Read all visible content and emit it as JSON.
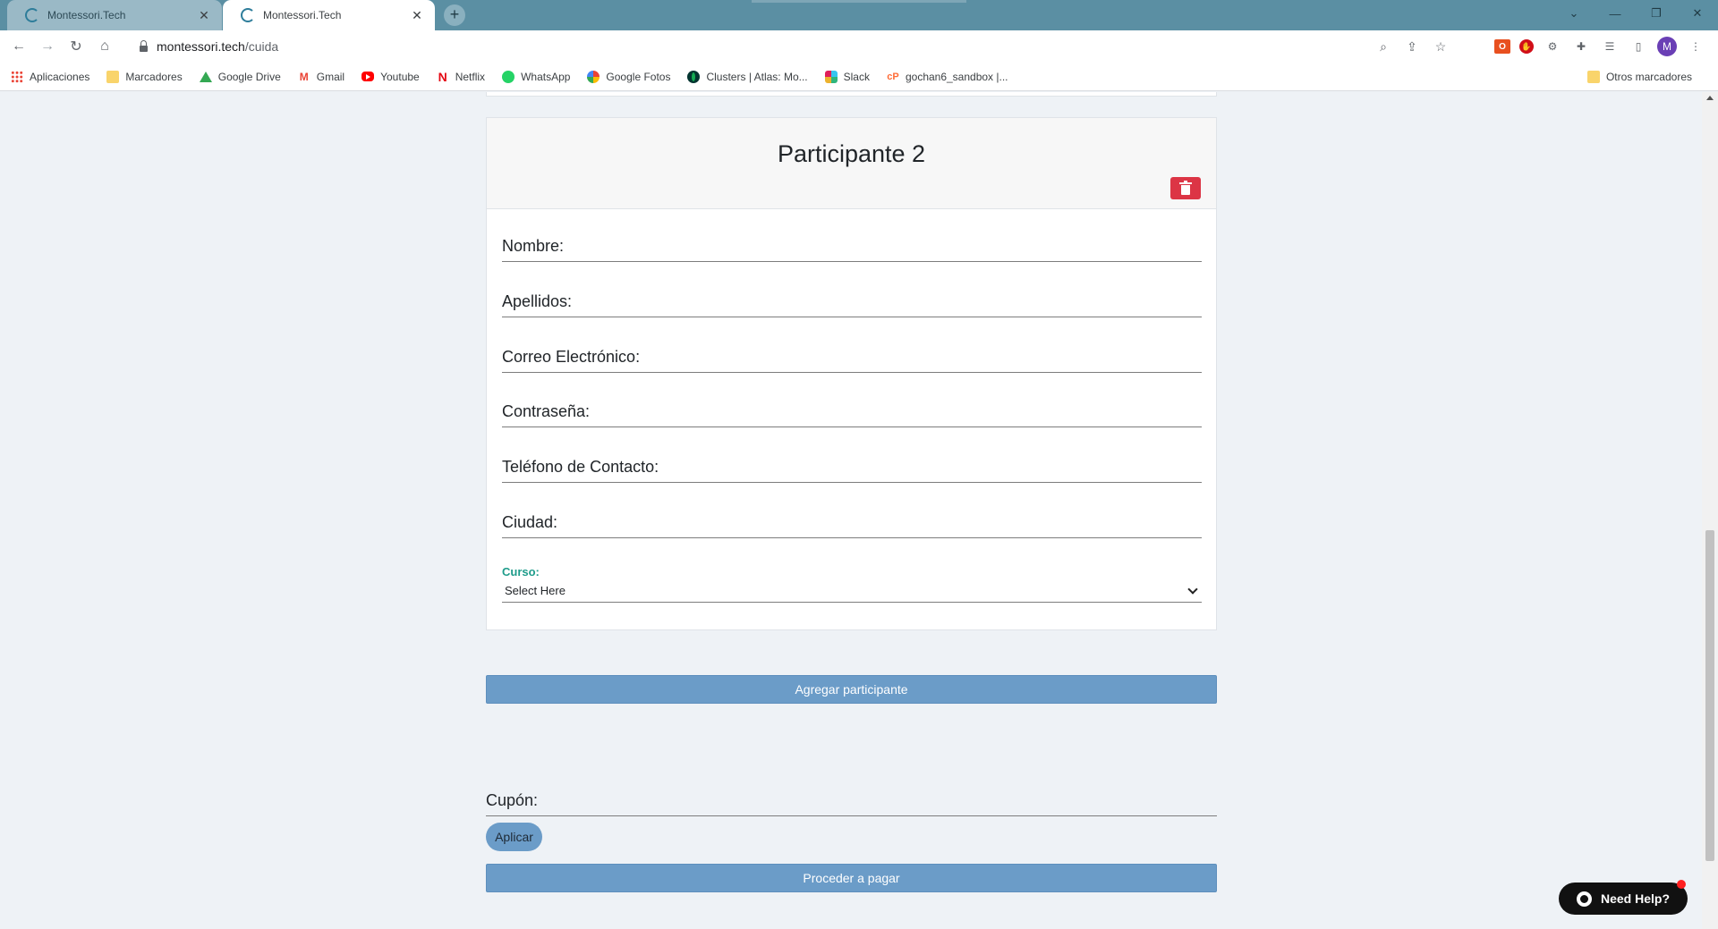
{
  "browser": {
    "tabs": [
      {
        "title": "Montessori.Tech",
        "active": false
      },
      {
        "title": "Montessori.Tech",
        "active": true
      }
    ],
    "new_tab_label": "+",
    "url_host": "montessori.tech",
    "url_path": "/cuida",
    "profile_initial": "M",
    "office_ext_label": "O",
    "bookmarks": [
      {
        "label": "Aplicaciones",
        "icon": "apps-grid-icon"
      },
      {
        "label": "Marcadores",
        "icon": "folder-icon"
      },
      {
        "label": "Google Drive",
        "icon": "google-drive-icon"
      },
      {
        "label": "Gmail",
        "icon": "gmail-icon"
      },
      {
        "label": "Youtube",
        "icon": "youtube-icon"
      },
      {
        "label": "Netflix",
        "icon": "netflix-icon"
      },
      {
        "label": "WhatsApp",
        "icon": "whatsapp-icon"
      },
      {
        "label": "Google Fotos",
        "icon": "google-photos-icon"
      },
      {
        "label": "Clusters | Atlas: Mo...",
        "icon": "mongodb-icon"
      },
      {
        "label": "Slack",
        "icon": "slack-icon"
      },
      {
        "label": "gochan6_sandbox |...",
        "icon": "postman-icon"
      }
    ],
    "other_bookmarks": "Otros marcadores"
  },
  "participant": {
    "title": "Participante 2",
    "fields": {
      "nombre": "Nombre:",
      "apellidos": "Apellidos:",
      "correo": "Correo Electrónico:",
      "contrasena": "Contraseña:",
      "telefono": "Teléfono de Contacto:",
      "ciudad": "Ciudad:"
    },
    "curso_label": "Curso:",
    "curso_selected": "Select Here"
  },
  "actions": {
    "add_participant": "Agregar participante",
    "coupon_label": "Cupón:",
    "apply": "Aplicar",
    "proceed": "Proceder a pagar"
  },
  "help": {
    "label": "Need Help?"
  },
  "colors": {
    "primary_button": "#6b9cc8",
    "delete_button": "#dc3545",
    "select_label": "#1f9c8b",
    "page_bg": "#eef2f6",
    "tabbar": "#5b8fa3"
  }
}
